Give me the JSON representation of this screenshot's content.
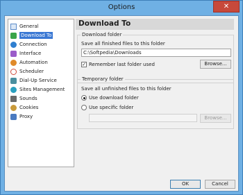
{
  "window": {
    "title": "Options",
    "close_glyph": "✕"
  },
  "sidebar": {
    "items": [
      {
        "label": "General",
        "icon": "general-icon",
        "color": "#5a8ac8"
      },
      {
        "label": "Download To",
        "icon": "download-to-icon",
        "color": "#3aa54a",
        "selected": true
      },
      {
        "label": "Connection",
        "icon": "connection-icon",
        "color": "#2f7fd0"
      },
      {
        "label": "Interface",
        "icon": "interface-icon",
        "color": "#9b5cc9"
      },
      {
        "label": "Automation",
        "icon": "automation-icon",
        "color": "#e08a2a"
      },
      {
        "label": "Scheduler",
        "icon": "scheduler-icon",
        "color": "#d04a3a"
      },
      {
        "label": "Dial-Up Service",
        "icon": "dialup-icon",
        "color": "#4a8f9f"
      },
      {
        "label": "Sites Management",
        "icon": "sites-management-icon",
        "color": "#2aa0c0"
      },
      {
        "label": "Sounds",
        "icon": "sounds-icon",
        "color": "#6a6a6a"
      },
      {
        "label": "Cookies",
        "icon": "cookies-icon",
        "color": "#c99a3a"
      },
      {
        "label": "Proxy",
        "icon": "proxy-icon",
        "color": "#4a7ac0"
      }
    ]
  },
  "page": {
    "title": "Download To"
  },
  "download_folder": {
    "group_label": "Download folder",
    "hint": "Save all finished files to this folder",
    "path": "C:\\Softpedia\\Downloads",
    "remember_label": "Remember last folder used",
    "remember_checked": true,
    "browse_label": "Browse..."
  },
  "temporary_folder": {
    "group_label": "Temporary folder",
    "hint": "Save all unfinished files to this folder",
    "option_download_label": "Use download folder",
    "option_specific_label": "Use specific folder",
    "specific_path": "",
    "browse_label": "Browse..."
  },
  "footer": {
    "ok_label": "OK",
    "cancel_label": "Cancel"
  }
}
